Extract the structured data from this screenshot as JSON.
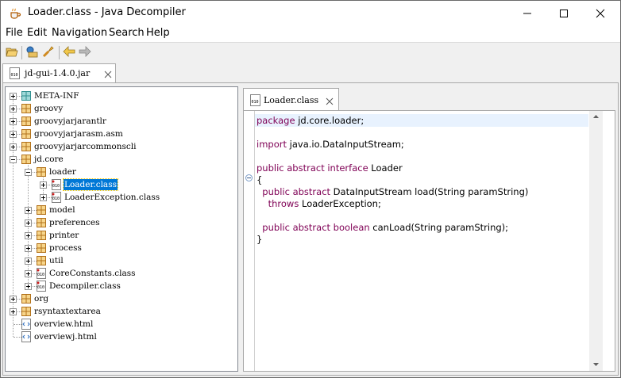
{
  "window": {
    "title": "Loader.class - Java Decompiler"
  },
  "menu": [
    "File",
    "Edit",
    "Navigation",
    "Search",
    "Help"
  ],
  "outer_tab": {
    "label": "jd-gui-1.4.0.jar"
  },
  "tree": [
    {
      "label": "META-INF",
      "depth": 0,
      "expander": "plus",
      "icon": "folder-icon"
    },
    {
      "label": "groovy",
      "depth": 0,
      "expander": "plus",
      "icon": "package-icon"
    },
    {
      "label": "groovyjarjarantlr",
      "depth": 0,
      "expander": "plus",
      "icon": "package-icon"
    },
    {
      "label": "groovyjarjarasm.asm",
      "depth": 0,
      "expander": "plus",
      "icon": "package-icon"
    },
    {
      "label": "groovyjarjarcommonscli",
      "depth": 0,
      "expander": "plus",
      "icon": "package-icon"
    },
    {
      "label": "jd.core",
      "depth": 0,
      "expander": "minus",
      "icon": "package-icon"
    },
    {
      "label": "loader",
      "depth": 1,
      "expander": "minus",
      "icon": "package-icon"
    },
    {
      "label": "Loader.class",
      "depth": 2,
      "expander": "plus",
      "icon": "class-file-icon",
      "selected": true
    },
    {
      "label": "LoaderException.class",
      "depth": 2,
      "expander": "plus",
      "icon": "class-file-icon"
    },
    {
      "label": "model",
      "depth": 1,
      "expander": "plus",
      "icon": "package-icon"
    },
    {
      "label": "preferences",
      "depth": 1,
      "expander": "plus",
      "icon": "package-icon"
    },
    {
      "label": "printer",
      "depth": 1,
      "expander": "plus",
      "icon": "package-icon"
    },
    {
      "label": "process",
      "depth": 1,
      "expander": "plus",
      "icon": "package-icon"
    },
    {
      "label": "util",
      "depth": 1,
      "expander": "plus",
      "icon": "package-icon"
    },
    {
      "label": "CoreConstants.class",
      "depth": 1,
      "expander": "plus",
      "icon": "class-file-icon"
    },
    {
      "label": "Decompiler.class",
      "depth": 1,
      "expander": "plus",
      "icon": "class-file-icon"
    },
    {
      "label": "org",
      "depth": 0,
      "expander": "plus",
      "icon": "package-icon"
    },
    {
      "label": "rsyntaxtextarea",
      "depth": 0,
      "expander": "plus",
      "icon": "package-icon"
    },
    {
      "label": "overview.html",
      "depth": 0,
      "expander": "none",
      "icon": "html-file-icon"
    },
    {
      "label": "overviewj.html",
      "depth": 0,
      "expander": "none",
      "icon": "html-file-icon"
    }
  ],
  "inner_tab": {
    "label": "Loader.class"
  },
  "code": [
    {
      "kw": "package",
      "rest": " jd.core.loader;"
    },
    {
      "kw": "",
      "rest": ""
    },
    {
      "kw": "import",
      "rest": " java.io.DataInputStream;"
    },
    {
      "kw": "",
      "rest": ""
    },
    {
      "kw": "public abstract interface",
      "rest": " Loader"
    },
    {
      "kw": "",
      "rest": "{"
    },
    {
      "kw": "  public abstract",
      "rest": " DataInputStream load(String paramString)"
    },
    {
      "kw": "    throws",
      "rest": " LoaderException;"
    },
    {
      "kw": "",
      "rest": ""
    },
    {
      "kw": "  public abstract boolean",
      "rest": " canLoad(String paramString);"
    },
    {
      "kw": "",
      "rest": "}"
    }
  ],
  "colors": {
    "keyword": "#7f0055",
    "selection": "#0078d7",
    "current_line": "#e8f2fe"
  }
}
